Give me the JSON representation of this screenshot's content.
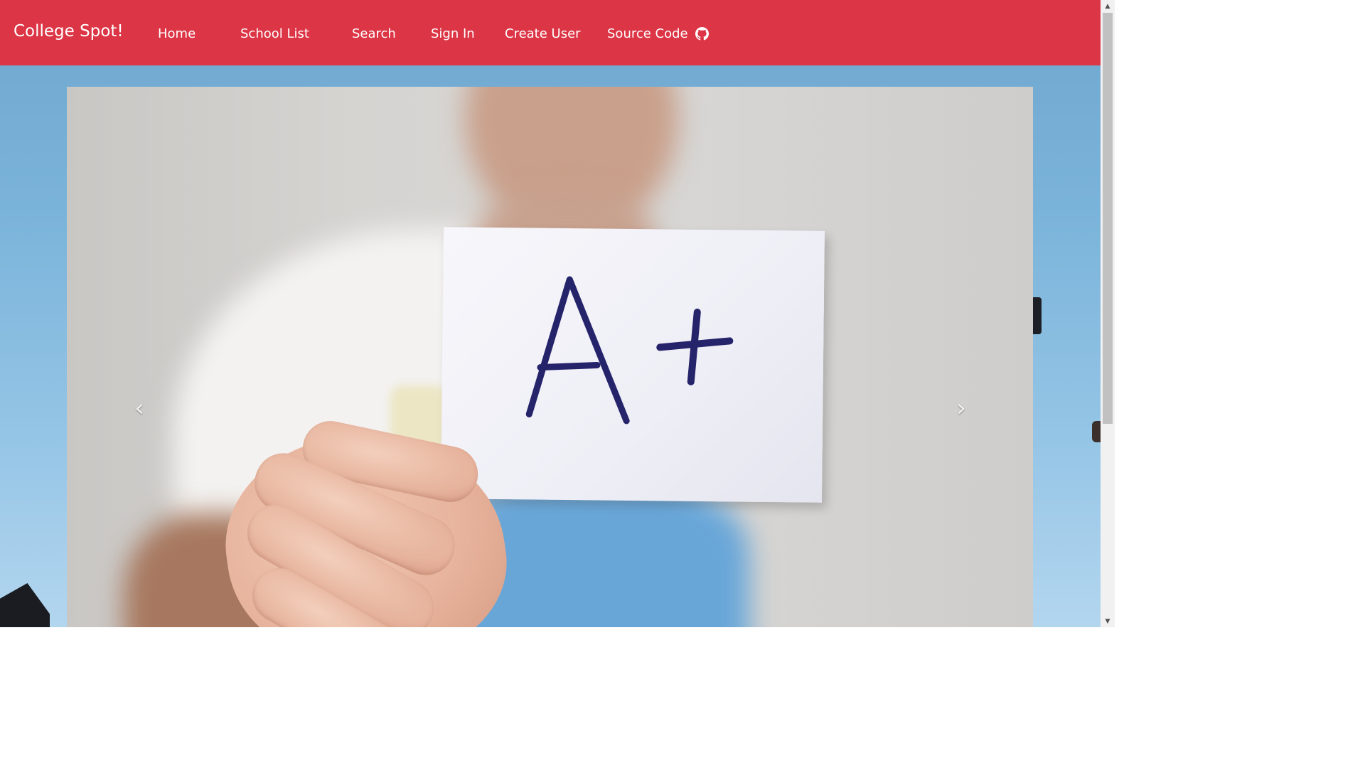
{
  "navbar": {
    "brand": "College Spot!",
    "links": {
      "home": "Home",
      "school_list": "School List",
      "search": "Search",
      "sign_in": "Sign In",
      "create_user": "Create User",
      "source_code": "Source Code"
    },
    "source_icon": "github-icon",
    "background_color": "#dc3545"
  },
  "carousel": {
    "slide_text": "A+",
    "prev_icon": "chevron-left-icon",
    "next_icon": "chevron-right-icon",
    "prev_glyph": "‹",
    "next_glyph": "›"
  },
  "scrollbar": {
    "up_glyph": "▲",
    "down_glyph": "▼"
  }
}
